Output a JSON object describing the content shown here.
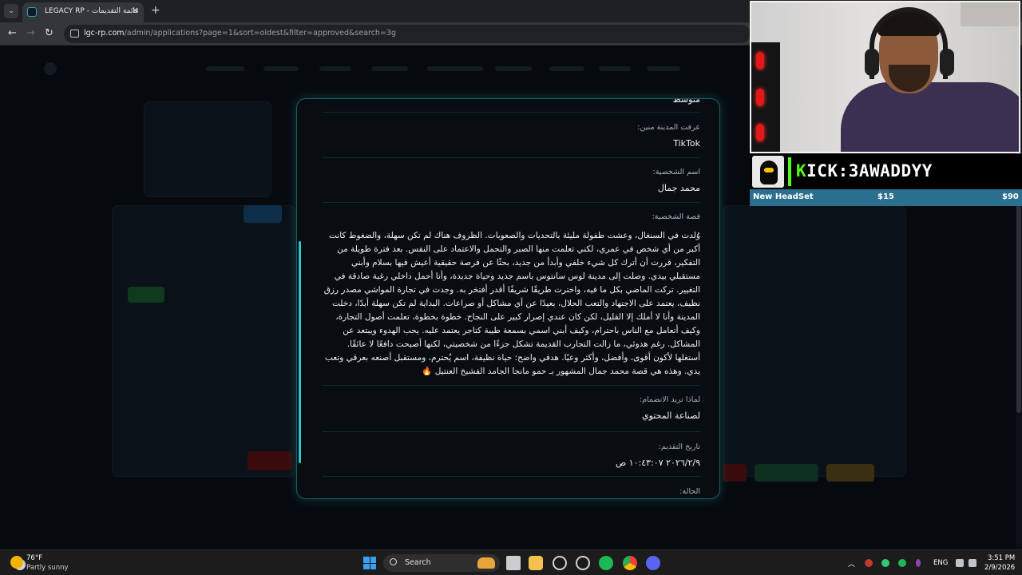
{
  "browser": {
    "tab_title": "LEGACY RP - قائمة التقديمات",
    "url_host": "lgc-rp.com",
    "url_path": "/admin/applications?page=1&sort=oldest&filter=approved&search=3g",
    "tab_close": "✕",
    "new_tab": "+",
    "back": "←",
    "forward": "→",
    "reload": "↻",
    "tab_menu": "⌄"
  },
  "modal": {
    "partial_top_value": "متوسط",
    "fields": [
      {
        "label": "عرفت المدينة منين:",
        "value": "TikTok"
      },
      {
        "label": "اسم الشخصية:",
        "value": "محمد جمال"
      },
      {
        "label": "قصة الشخصية:",
        "value": "وُلدت في السنغال، وعشت طفولة مليئة بالتحديات والصعوبات. الظروف هناك لم تكن سهلة، والضغوط كانت أكبر من أي شخص في عمري، لكني تعلمت منها الصبر والتحمل والاعتماد على النفس. بعد فترة طويلة من التفكير، قررت أن أترك كل شيء خلفي وأبدأ من جديد، بحثًا عن فرصة حقيقية أعيش فيها بسلام وأبني مستقبلي بيدي. وصلت إلى مدينة لوس سانتوس باسم جديد وحياة جديدة، وأنا أحمل داخلي رغبة صادقة في التغيير. تركت الماضي بكل ما فيه، واخترت طريقًا شريفًا أقدر أفتخر به. وجدت في تجارة المواشي مصدر رزق نظيف، يعتمد على الاجتهاد والتعب الحلال، بعيدًا عن أي مشاكل أو صراعات. البداية لم تكن سهلة أبدًا، دخلت المدينة وأنا لا أملك إلا القليل، لكن كان عندي إصرار كبير على النجاح. خطوة بخطوة، تعلمت أصول التجارة، وكيف أتعامل مع الناس باحترام، وكيف أبني اسمي بسمعة طيبة كتاجر يعتمد عليه. يحب الهدوء ويبتعد عن المشاكل. رغم هدوئي، ما زالت التجارب القديمة تشكل جزءًا من شخصيتي، لكنها أصبحت دافعًا لا عائقًا. أستغلها لأكون أقوى، وأفضل، وأكثر وعيًا. هدفي واضح: حياة نظيفة، اسم يُحترم، ومستقبل أصنعه بعرقي وتعب يدي. وهذه هي قصة محمد جمال المشهور بـ حمو مانجا الجامد الفشيخ العنتيل 🔥"
      },
      {
        "label": "لماذا تريد الانضمام:",
        "value": "لصناعة المحتوي"
      },
      {
        "label": "تاريخ التقديم:",
        "value": "٢٠٢٦/٢/٩ ١٠:٤٣:٠٧ ص"
      },
      {
        "label": "الحالة:",
        "value": ""
      }
    ]
  },
  "stream": {
    "channel_prefix": "K",
    "channel_rest": "ICK:3AWADDYY",
    "goal_name": "New HeadSet",
    "goal_current": "$15",
    "goal_target": "$90"
  },
  "taskbar": {
    "weather_temp": "76°F",
    "weather_desc": "Partly sunny",
    "search_label": "Search",
    "language": "ENG",
    "time": "3:51 PM",
    "date": "2/9/2026"
  },
  "colors": {
    "accent": "#2ec8d2",
    "kick_green": "#53fc18",
    "goal_bar": "#2b6f8e"
  }
}
